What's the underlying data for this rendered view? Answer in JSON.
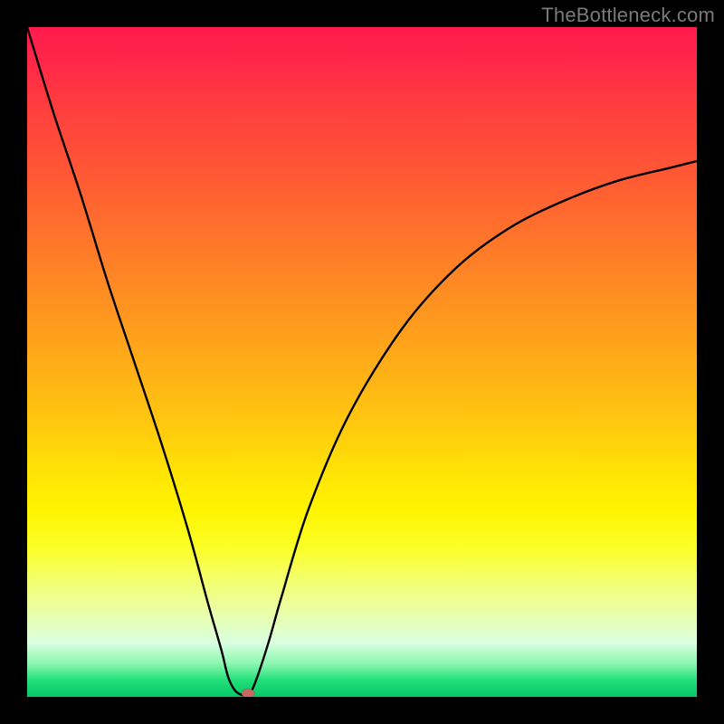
{
  "watermark": "TheBottleneck.com",
  "chart_data": {
    "type": "line",
    "title": "",
    "xlabel": "",
    "ylabel": "",
    "xlim": [
      0,
      100
    ],
    "ylim": [
      0,
      100
    ],
    "grid": false,
    "legend": false,
    "background": "rainbow-gradient vertical (red top to green bottom)",
    "series": [
      {
        "name": "bottleneck-curve",
        "type": "line",
        "color": "#000000",
        "x": [
          0,
          4,
          8,
          12,
          16,
          20,
          24,
          27,
          29,
          30,
          31,
          32,
          33,
          34,
          36,
          38,
          42,
          48,
          56,
          64,
          72,
          80,
          88,
          96,
          100
        ],
        "y": [
          100,
          87,
          75,
          62,
          50,
          38,
          25,
          14,
          7,
          3,
          1,
          0.3,
          0.3,
          2,
          8,
          15,
          28,
          42,
          55,
          64,
          70,
          74,
          77,
          79,
          80
        ]
      }
    ],
    "marker": {
      "x": 33,
      "y": 0.5,
      "color": "#c66a5f",
      "shape": "ellipse"
    }
  }
}
